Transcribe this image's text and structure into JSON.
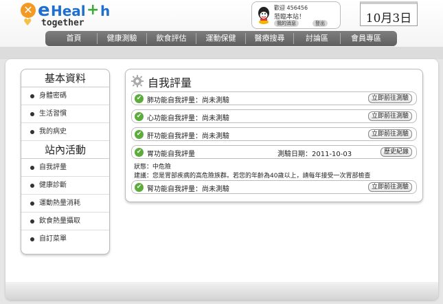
{
  "header": {
    "logo": {
      "text_e": "e",
      "text_heal": "Heal",
      "text_plus": "+",
      "text_h": "h",
      "text_together": "together"
    },
    "user_box": {
      "line1": "歡迎 456456",
      "line2": "蒞臨本站！",
      "messages_button": "我的消息",
      "logout_button": "登出"
    },
    "date": "10月3日",
    "nav": [
      "首頁",
      "健康測驗",
      "飲食評估",
      "運動保健",
      "醫療搜尋",
      "討論區",
      "會員專區"
    ]
  },
  "sidebar": {
    "section1_title": "基本資料",
    "section1_items": [
      "身體密碼",
      "生活習慣",
      "我的病史"
    ],
    "section2_title": "站內活動",
    "section2_items": [
      "自我評量",
      "健康診斷",
      "運動熱量消耗",
      "飲食熱量攝取",
      "自訂菜單"
    ]
  },
  "content": {
    "title": "自我評量",
    "rows": [
      {
        "label": "肺功能自我評量：尚未測驗",
        "button": "立即前往測驗"
      },
      {
        "label": "心功能自我評量：尚未測驗",
        "button": "立即前往測驗"
      },
      {
        "label": "肝功能自我評量：尚未測驗",
        "button": "立即前往測驗"
      },
      {
        "label": "胃功能自我評量",
        "date": "測驗日期：2011-10-03",
        "button": "歷史紀錄"
      },
      {
        "label": "腎功能自我評量：尚未測驗",
        "button": "立即前往測驗"
      }
    ],
    "stomach_status": "狀態：中危險",
    "stomach_advice": "建議：您是胃部疾病的高危險族群。若您的年齡為40歲以上，請每年接受一次胃部檢查"
  },
  "colors": {
    "check_green": "#5cac3c",
    "logo_blue": "#1f6fd1",
    "logo_orange": "#f39a24",
    "nav_gray": "#6e6e6e"
  }
}
